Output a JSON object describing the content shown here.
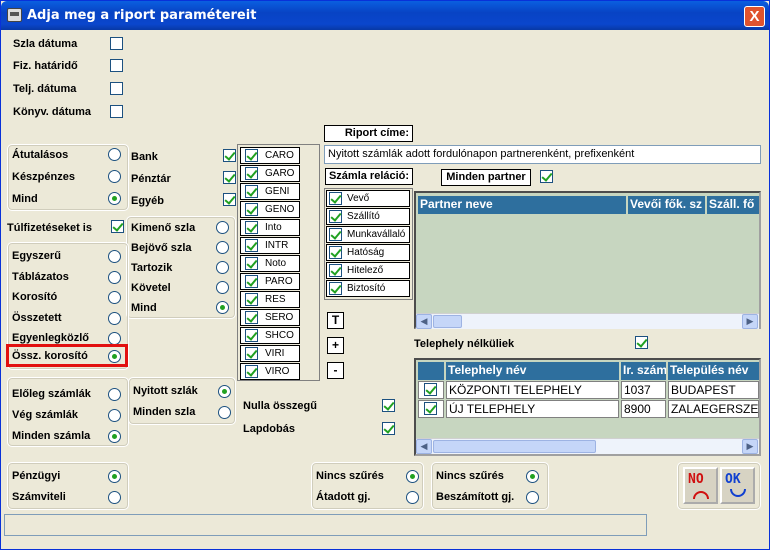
{
  "window": {
    "title": "Adja meg a riport paramétereit",
    "close": "X"
  },
  "dates": [
    {
      "label": "Szla dátuma",
      "checked": false
    },
    {
      "label": "Fiz. határidő",
      "checked": false
    },
    {
      "label": "Telj. dátuma",
      "checked": false
    },
    {
      "label": "Könyv. dátuma",
      "checked": false
    }
  ],
  "payment": [
    {
      "label": "Átutalásos",
      "selected": false
    },
    {
      "label": "Készpénzes",
      "selected": false
    },
    {
      "label": "Mind",
      "selected": true
    }
  ],
  "type": [
    {
      "label": "Bank",
      "checked": true
    },
    {
      "label": "Pénztár",
      "checked": true
    },
    {
      "label": "Egyéb",
      "checked": true
    }
  ],
  "overpaid": {
    "label": "Túlfizetéseket is",
    "checked": true
  },
  "direction": [
    {
      "label": "Kimenő szla",
      "selected": false
    },
    {
      "label": "Bejövő szla",
      "selected": false
    },
    {
      "label": "Tartozik",
      "selected": false
    },
    {
      "label": "Követel",
      "selected": false
    },
    {
      "label": "Mind",
      "selected": true
    }
  ],
  "layout": [
    {
      "label": "Egyszerű",
      "selected": false
    },
    {
      "label": "Táblázatos",
      "selected": false
    },
    {
      "label": "Korosító",
      "selected": false
    },
    {
      "label": "Összetett",
      "selected": false
    },
    {
      "label": "Egyenlegközlő",
      "selected": false
    },
    {
      "label": "Össz. korosító",
      "selected": true
    }
  ],
  "prefixes": [
    {
      "code": "CARO",
      "checked": true
    },
    {
      "code": "GARO",
      "checked": true
    },
    {
      "code": "GENI",
      "checked": true
    },
    {
      "code": "GENO",
      "checked": true
    },
    {
      "code": "Into",
      "checked": true
    },
    {
      "code": "INTR",
      "checked": true
    },
    {
      "code": "Noto",
      "checked": true
    },
    {
      "code": "PARO",
      "checked": true
    },
    {
      "code": "RES",
      "checked": true
    },
    {
      "code": "SERO",
      "checked": true
    },
    {
      "code": "SHCO",
      "checked": true
    },
    {
      "code": "VIRI",
      "checked": true
    },
    {
      "code": "VIRO",
      "checked": true
    }
  ],
  "report_title": {
    "label": "Riport címe:",
    "value": "Nyitott számlák adott fordulónapon partnerenként, prefixenként"
  },
  "relation": {
    "label": "Számla reláció:",
    "items": [
      {
        "label": "Vevő",
        "checked": true
      },
      {
        "label": "Szállító",
        "checked": true
      },
      {
        "label": "Munkavállaló",
        "checked": true
      },
      {
        "label": "Hatóság",
        "checked": true
      },
      {
        "label": "Hitelező",
        "checked": true
      },
      {
        "label": "Biztosító",
        "checked": true
      }
    ]
  },
  "all_partners": {
    "label": "Minden partner",
    "checked": true
  },
  "partner_grid": {
    "headers": [
      "Partner neve",
      "Vevői fők. sz",
      "Száll. fő"
    ]
  },
  "toolbar": {
    "t": "T",
    "plus": "+",
    "minus": "-"
  },
  "no_site": {
    "label": "Telephely nélküliek",
    "checked": true
  },
  "site_grid": {
    "headers": [
      "Telephely név",
      "Ir. szám",
      "Település név"
    ],
    "rows": [
      {
        "checked": true,
        "name": "KÖZPONTI TELEPHELY",
        "zip": "1037",
        "city": "BUDAPEST"
      },
      {
        "checked": true,
        "name": "ÚJ TELEPHELY",
        "zip": "8900",
        "city": "ZALAEGERSZEG"
      }
    ]
  },
  "invoice_kind": [
    {
      "label": "Előleg számlák",
      "selected": false
    },
    {
      "label": "Vég számlák",
      "selected": false
    },
    {
      "label": "Minden számla",
      "selected": true
    }
  ],
  "open_filter": [
    {
      "label": "Nyitott szlák",
      "selected": true
    },
    {
      "label": "Minden szla",
      "selected": false
    }
  ],
  "zero": {
    "label": "Nulla összegű",
    "checked": true
  },
  "lapdobas": {
    "label": "Lapdobás",
    "checked": true
  },
  "ledger": [
    {
      "label": "Pénzügyi",
      "selected": true
    },
    {
      "label": "Számviteli",
      "selected": false
    }
  ],
  "filter1": [
    {
      "label": "Nincs szűrés",
      "selected": true
    },
    {
      "label": "Átadott gj.",
      "selected": false
    }
  ],
  "filter2": [
    {
      "label": "Nincs szűrés",
      "selected": true
    },
    {
      "label": "Beszámított gj.",
      "selected": false
    }
  ],
  "buttons": {
    "no": "NO",
    "ok": "OK"
  },
  "colors": {
    "titlebar": "#0a46cc",
    "grid_bg": "#c7d6c0",
    "grid_header": "#2e6f9e",
    "highlight": "#e21010"
  }
}
